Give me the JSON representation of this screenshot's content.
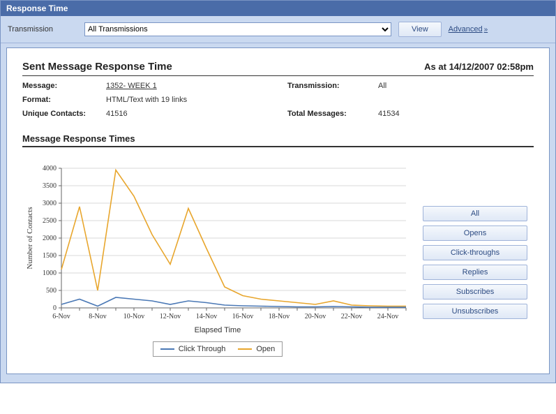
{
  "panel": {
    "title": "Response Time"
  },
  "toolbar": {
    "transmission_label": "Transmission",
    "transmission_value": "All Transmissions",
    "view_label": "View",
    "advanced_label": "Advanced"
  },
  "report": {
    "title": "Sent Message Response Time",
    "asat_prefix": "As at ",
    "asat": "14/12/2007 02:58pm",
    "meta": {
      "message_label": "Message:",
      "message_value": "1352- WEEK 1",
      "transmission_label": "Transmission:",
      "transmission_value": "All",
      "format_label": "Format:",
      "format_value": "HTML/Text with 19 links",
      "unique_label": "Unique Contacts:",
      "unique_value": "41516",
      "total_label": "Total Messages:",
      "total_value": "41534"
    },
    "section_title": "Message Response Times",
    "chart": {
      "ylabel": "Number of Contacts",
      "xlabel": "Elapsed Time",
      "legend_click": "Click Through",
      "legend_open": "Open"
    },
    "side_buttons": {
      "all": "All",
      "opens": "Opens",
      "clicks": "Click-throughs",
      "replies": "Replies",
      "subs": "Subscribes",
      "unsubs": "Unsubscribes"
    }
  },
  "colors": {
    "open": "#e8a62d",
    "click": "#4a78b5"
  },
  "chart_data": {
    "type": "line",
    "xlabel": "Elapsed Time",
    "ylabel": "Number of Contacts",
    "title": "Message Response Times",
    "ylim": [
      0,
      4000
    ],
    "yticks": [
      0,
      500,
      1000,
      1500,
      2000,
      2500,
      3000,
      3500,
      4000
    ],
    "categories": [
      "6-Nov",
      "7-Nov",
      "8-Nov",
      "9-Nov",
      "10-Nov",
      "11-Nov",
      "12-Nov",
      "13-Nov",
      "14-Nov",
      "15-Nov",
      "16-Nov",
      "17-Nov",
      "18-Nov",
      "19-Nov",
      "20-Nov",
      "21-Nov",
      "22-Nov",
      "23-Nov",
      "24-Nov",
      "25-Nov"
    ],
    "xtick_labels": [
      "6-Nov",
      "8-Nov",
      "10-Nov",
      "12-Nov",
      "14-Nov",
      "16-Nov",
      "18-Nov",
      "20-Nov",
      "22-Nov",
      "24-Nov"
    ],
    "series": [
      {
        "name": "Open",
        "color": "#e8a62d",
        "values": [
          1100,
          2900,
          500,
          3950,
          3200,
          2100,
          1250,
          2850,
          1700,
          600,
          350,
          250,
          200,
          150,
          100,
          200,
          80,
          60,
          50,
          50
        ]
      },
      {
        "name": "Click Through",
        "color": "#4a78b5",
        "values": [
          100,
          250,
          50,
          300,
          250,
          200,
          100,
          200,
          150,
          80,
          60,
          50,
          40,
          30,
          30,
          40,
          30,
          20,
          20,
          20
        ]
      }
    ]
  }
}
